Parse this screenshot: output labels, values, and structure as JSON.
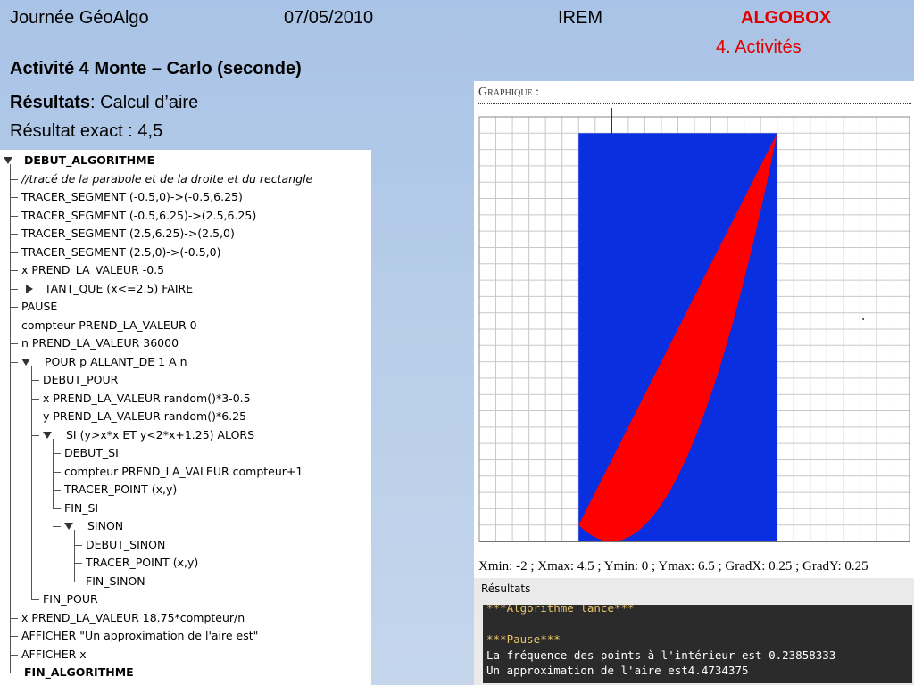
{
  "header": {
    "event": "Journée GéoAlgo",
    "date": "07/05/2010",
    "org": "IREM",
    "brand": "ALGOBOX",
    "section": "4. Activités",
    "brand_color": "#e00000"
  },
  "title": "Activité 4  Monte – Carlo (seconde)",
  "results_label": "Résultats",
  "results_text": ": Calcul d’aire",
  "exact_result": "Résultat exact : 4,5",
  "tree": [
    {
      "text": "DEBUT_ALGORITHME",
      "style": "bold"
    },
    {
      "text": "//tracé de la parabole et de la droite et du rectangle",
      "style": "ital"
    },
    {
      "text": "TRACER_SEGMENT (-0.5,0)->(-0.5,6.25)"
    },
    {
      "text": "TRACER_SEGMENT (-0.5,6.25)->(2.5,6.25)"
    },
    {
      "text": "TRACER_SEGMENT (2.5,6.25)->(2.5,0)"
    },
    {
      "text": "TRACER_SEGMENT (2.5,0)->(-0.5,0)"
    },
    {
      "text": "x PREND_LA_VALEUR -0.5"
    },
    {
      "text": "TANT_QUE (x<=2.5) FAIRE"
    },
    {
      "text": "PAUSE"
    },
    {
      "text": "compteur PREND_LA_VALEUR 0"
    },
    {
      "text": "n PREND_LA_VALEUR 36000"
    },
    {
      "text": "POUR p ALLANT_DE 1 A n"
    },
    {
      "text": "DEBUT_POUR"
    },
    {
      "text": "x PREND_LA_VALEUR random()*3-0.5"
    },
    {
      "text": "y PREND_LA_VALEUR random()*6.25"
    },
    {
      "text": "SI (y>x*x ET y<2*x+1.25) ALORS"
    },
    {
      "text": "DEBUT_SI"
    },
    {
      "text": "compteur PREND_LA_VALEUR compteur+1"
    },
    {
      "text": "TRACER_POINT (x,y)"
    },
    {
      "text": "FIN_SI"
    },
    {
      "text": "SINON"
    },
    {
      "text": "DEBUT_SINON"
    },
    {
      "text": "TRACER_POINT (x,y)"
    },
    {
      "text": "FIN_SINON"
    },
    {
      "text": "FIN_POUR"
    },
    {
      "text": "x PREND_LA_VALEUR 18.75*compteur/n"
    },
    {
      "text": "AFFICHER \"Un approximation de l'aire est\""
    },
    {
      "text": "AFFICHER x"
    },
    {
      "text": "FIN_ALGORITHME",
      "style": "bold"
    }
  ],
  "graph": {
    "heading": "Graphique :",
    "params": "Xmin: -2 ; Xmax: 4.5 ; Ymin: 0 ; Ymax: 6.5 ; GradX: 0.25 ; GradY: 0.25",
    "xmin": -2,
    "xmax": 4.5,
    "ymin": 0,
    "ymax": 6.5,
    "gradx": 0.25,
    "grady": 0.25,
    "rect_color": "#0a2fe0",
    "region_color": "#ff0000"
  },
  "results": {
    "label": "Résultats",
    "lines": [
      {
        "text": "***Algorithme lancé***",
        "style": "yel"
      },
      {
        "text": "",
        "style": ""
      },
      {
        "text": "***Pause***",
        "style": "yel"
      },
      {
        "text": "La fréquence des points à l'intérieur est 0.23858333",
        "style": ""
      },
      {
        "text": "Un approximation de l'aire est4.4734375",
        "style": ""
      }
    ]
  }
}
